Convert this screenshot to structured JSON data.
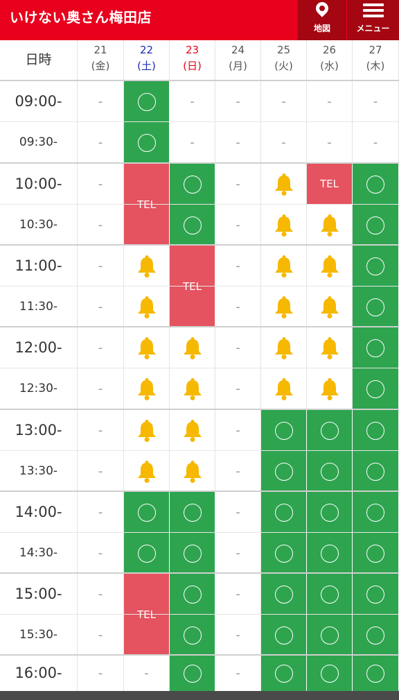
{
  "header": {
    "title": "いけない奥さん梅田店",
    "map_label": "地図",
    "menu_label": "メニュー"
  },
  "table": {
    "corner_label": "日時",
    "days": [
      {
        "date": "21",
        "weekday": "(金)",
        "kind": "weekday"
      },
      {
        "date": "22",
        "weekday": "(土)",
        "kind": "sat"
      },
      {
        "date": "23",
        "weekday": "(日)",
        "kind": "sun"
      },
      {
        "date": "24",
        "weekday": "(月)",
        "kind": "weekday"
      },
      {
        "date": "25",
        "weekday": "(火)",
        "kind": "weekday"
      },
      {
        "date": "26",
        "weekday": "(水)",
        "kind": "weekday"
      },
      {
        "date": "27",
        "weekday": "(木)",
        "kind": "weekday"
      }
    ],
    "dash_text": "-",
    "tel_text": "TEL",
    "times": [
      "09:00-",
      "09:30-",
      "10:00-",
      "10:30-",
      "11:00-",
      "11:30-",
      "12:00-",
      "12:30-",
      "13:00-",
      "13:30-",
      "14:00-",
      "14:30-",
      "15:00-",
      "15:30-",
      "16:00-"
    ],
    "slots": [
      [
        "-",
        "O",
        "-",
        "-",
        "-",
        "-",
        "-"
      ],
      [
        "-",
        "O",
        "-",
        "-",
        "-",
        "-",
        "-"
      ],
      [
        "-",
        "T",
        "O",
        "-",
        "B",
        "T",
        "O"
      ],
      [
        "-",
        "^",
        "O",
        "-",
        "B",
        "B",
        "O"
      ],
      [
        "-",
        "B",
        "T",
        "-",
        "B",
        "B",
        "O"
      ],
      [
        "-",
        "B",
        "^",
        "-",
        "B",
        "B",
        "O"
      ],
      [
        "-",
        "B",
        "B",
        "-",
        "B",
        "B",
        "O"
      ],
      [
        "-",
        "B",
        "B",
        "-",
        "B",
        "B",
        "O"
      ],
      [
        "-",
        "B",
        "B",
        "-",
        "O",
        "O",
        "O"
      ],
      [
        "-",
        "B",
        "B",
        "-",
        "O",
        "O",
        "O"
      ],
      [
        "-",
        "O",
        "O",
        "-",
        "O",
        "O",
        "O"
      ],
      [
        "-",
        "O",
        "O",
        "-",
        "O",
        "O",
        "O"
      ],
      [
        "-",
        "T",
        "O",
        "-",
        "O",
        "O",
        "O"
      ],
      [
        "-",
        "^",
        "O",
        "-",
        "O",
        "O",
        "O"
      ],
      [
        "-",
        "-",
        "O",
        "-",
        "O",
        "O",
        "O"
      ]
    ],
    "legend": {
      "O": "available",
      "B": "few-left",
      "T": "call",
      "-": "unavailable"
    }
  },
  "colors": {
    "header": "#e8001c",
    "header_btn": "#a40612",
    "available": "#2ea44f",
    "tel": "#e4535f",
    "bell": "#f6b800",
    "saturday": "#1a2bb0",
    "sunday": "#e8001c"
  }
}
